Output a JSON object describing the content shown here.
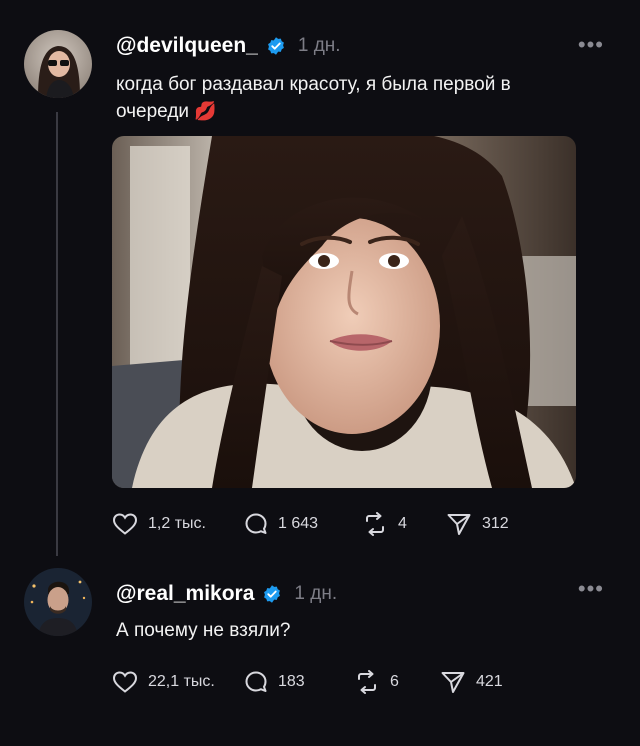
{
  "colors": {
    "background": "#0d0d12",
    "verified": "#1d9bf0",
    "muted": "#7d7d86"
  },
  "posts": [
    {
      "username": "@devilqueen_",
      "verified": true,
      "timestamp": "1 дн.",
      "text": "когда бог раздавал красоту, я была первой в очереди",
      "emoji": "💋",
      "has_image": true,
      "stats": {
        "likes": "1,2 тыс.",
        "replies": "1 643",
        "reposts": "4",
        "shares": "312"
      }
    },
    {
      "username": "@real_mikora",
      "verified": true,
      "timestamp": "1 дн.",
      "text": "А почему не взяли?",
      "stats": {
        "likes": "22,1 тыс.",
        "replies": "183",
        "reposts": "6",
        "shares": "421"
      }
    }
  ],
  "icons": {
    "like": "heart-icon",
    "reply": "comment-icon",
    "repost": "repost-icon",
    "share": "send-icon",
    "more": "more-dots-icon",
    "verified": "verified-badge-icon"
  }
}
